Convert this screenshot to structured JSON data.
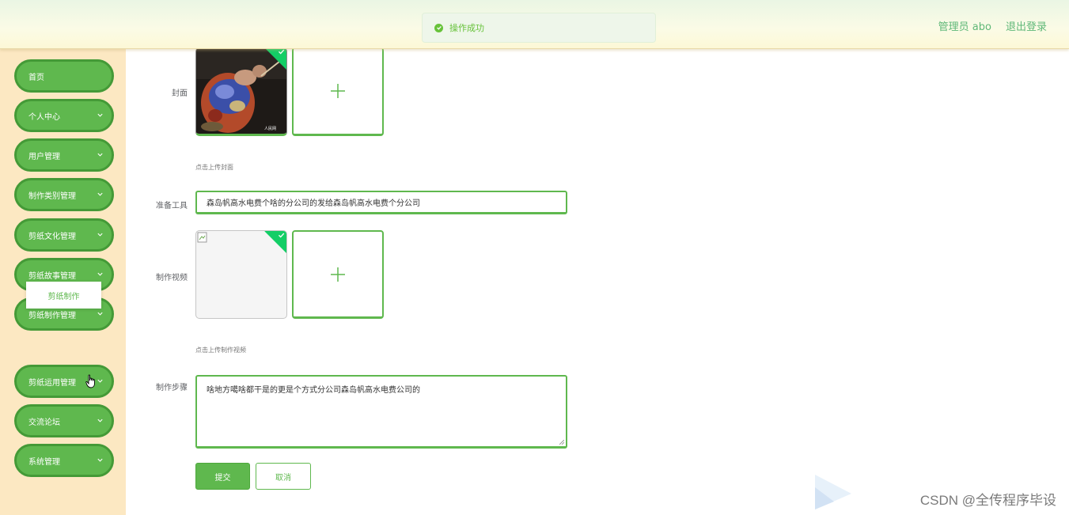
{
  "header": {
    "admin_label": "管理员 abo",
    "logout_label": "退出登录"
  },
  "toast": {
    "message": "操作成功"
  },
  "sidebar": {
    "items": [
      {
        "label": "首页"
      },
      {
        "label": "个人中心"
      },
      {
        "label": "用户管理"
      },
      {
        "label": "制作类别管理"
      },
      {
        "label": "剪纸文化管理"
      },
      {
        "label": "剪纸故事管理"
      },
      {
        "label": "剪纸制作管理"
      },
      {
        "label": "剪纸运用管理"
      },
      {
        "label": "交流论坛"
      },
      {
        "label": "系统管理"
      }
    ],
    "submenu_item": "剪纸制作"
  },
  "form": {
    "cover_label": "封面",
    "cover_hint": "点击上传封面",
    "tools_label": "准备工具",
    "tools_value": "森岛帆高水电费个啥的分公司的发给森岛帆高水电费个分公司",
    "video_label": "制作视频",
    "video_hint": "点击上传制作视频",
    "steps_label": "制作步骤",
    "steps_value": "啥地方噶啥都干是的更是个方式分公司森岛帆高水电费公司的",
    "submit_label": "提交",
    "cancel_label": "取消"
  },
  "watermark": "CSDN @全传程序毕设",
  "colors": {
    "accent": "#5fb84e",
    "success": "#67c23a",
    "sidebar_bg": "#fce8c2"
  }
}
